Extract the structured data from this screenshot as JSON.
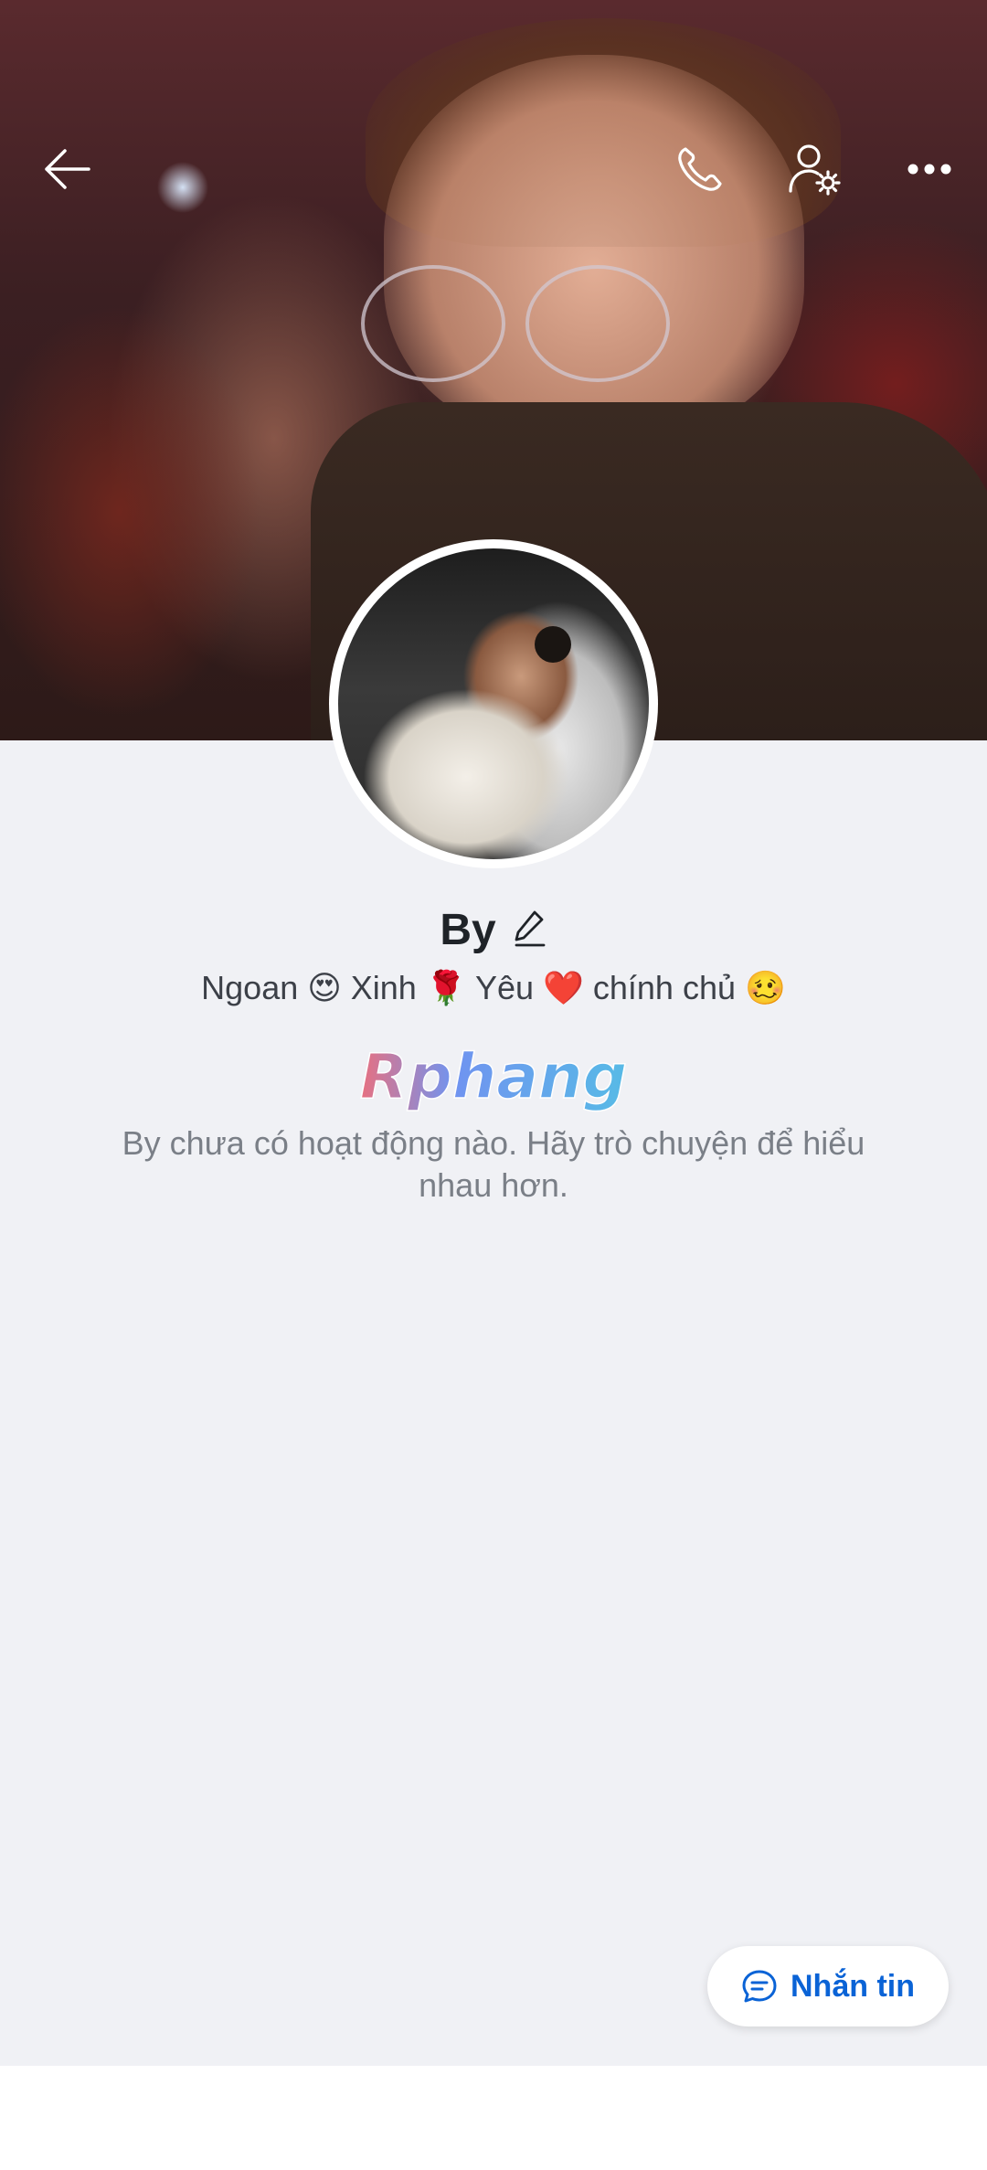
{
  "profile": {
    "name": "By",
    "bio": "Ngoan 😍 Xinh 🌹 Yêu ❤️ chính chủ 🥴",
    "empty_activity_message": "By chưa có hoạt động nào. Hãy trò chuyện để hiểu nhau hơn."
  },
  "watermark": {
    "text": "Rphang"
  },
  "header": {
    "icons": [
      "back-arrow-icon",
      "phone-icon",
      "user-settings-icon",
      "more-dots-icon"
    ]
  },
  "actions": {
    "message_label": "Nhắn tin",
    "message_icon": "chat-bubble-icon"
  },
  "colors": {
    "accent": "#0a63d6",
    "background": "#f0f1f5"
  }
}
